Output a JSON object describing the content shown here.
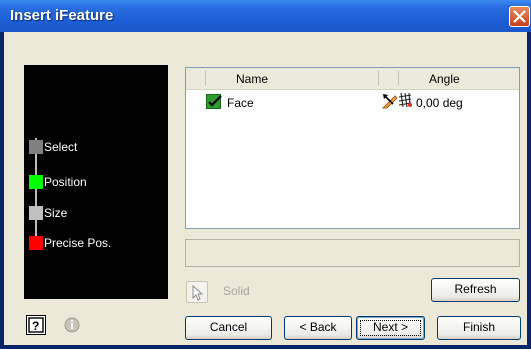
{
  "window": {
    "title": "Insert iFeature"
  },
  "steps": [
    {
      "label": "Select",
      "color": "#808080"
    },
    {
      "label": "Position",
      "color": "#00ff00"
    },
    {
      "label": "Size",
      "color": "#c0c0c0"
    },
    {
      "label": "Precise Pos.",
      "color": "#ff0000"
    }
  ],
  "table": {
    "columns": [
      "Name",
      "Angle"
    ],
    "rows": [
      {
        "name": "Face",
        "angle": "0,00 deg",
        "checked": true
      }
    ]
  },
  "selection": {
    "label": "Solid"
  },
  "buttons": {
    "refresh": "Refresh",
    "cancel": "Cancel",
    "back": "< Back",
    "next": "Next >",
    "finish": "Finish"
  },
  "icons": {
    "help": "help-icon",
    "info": "info-icon",
    "close": "close-icon",
    "cursor": "select-cursor-icon",
    "axis": "rotate-axis-icon",
    "grid": "mesh-icon"
  }
}
